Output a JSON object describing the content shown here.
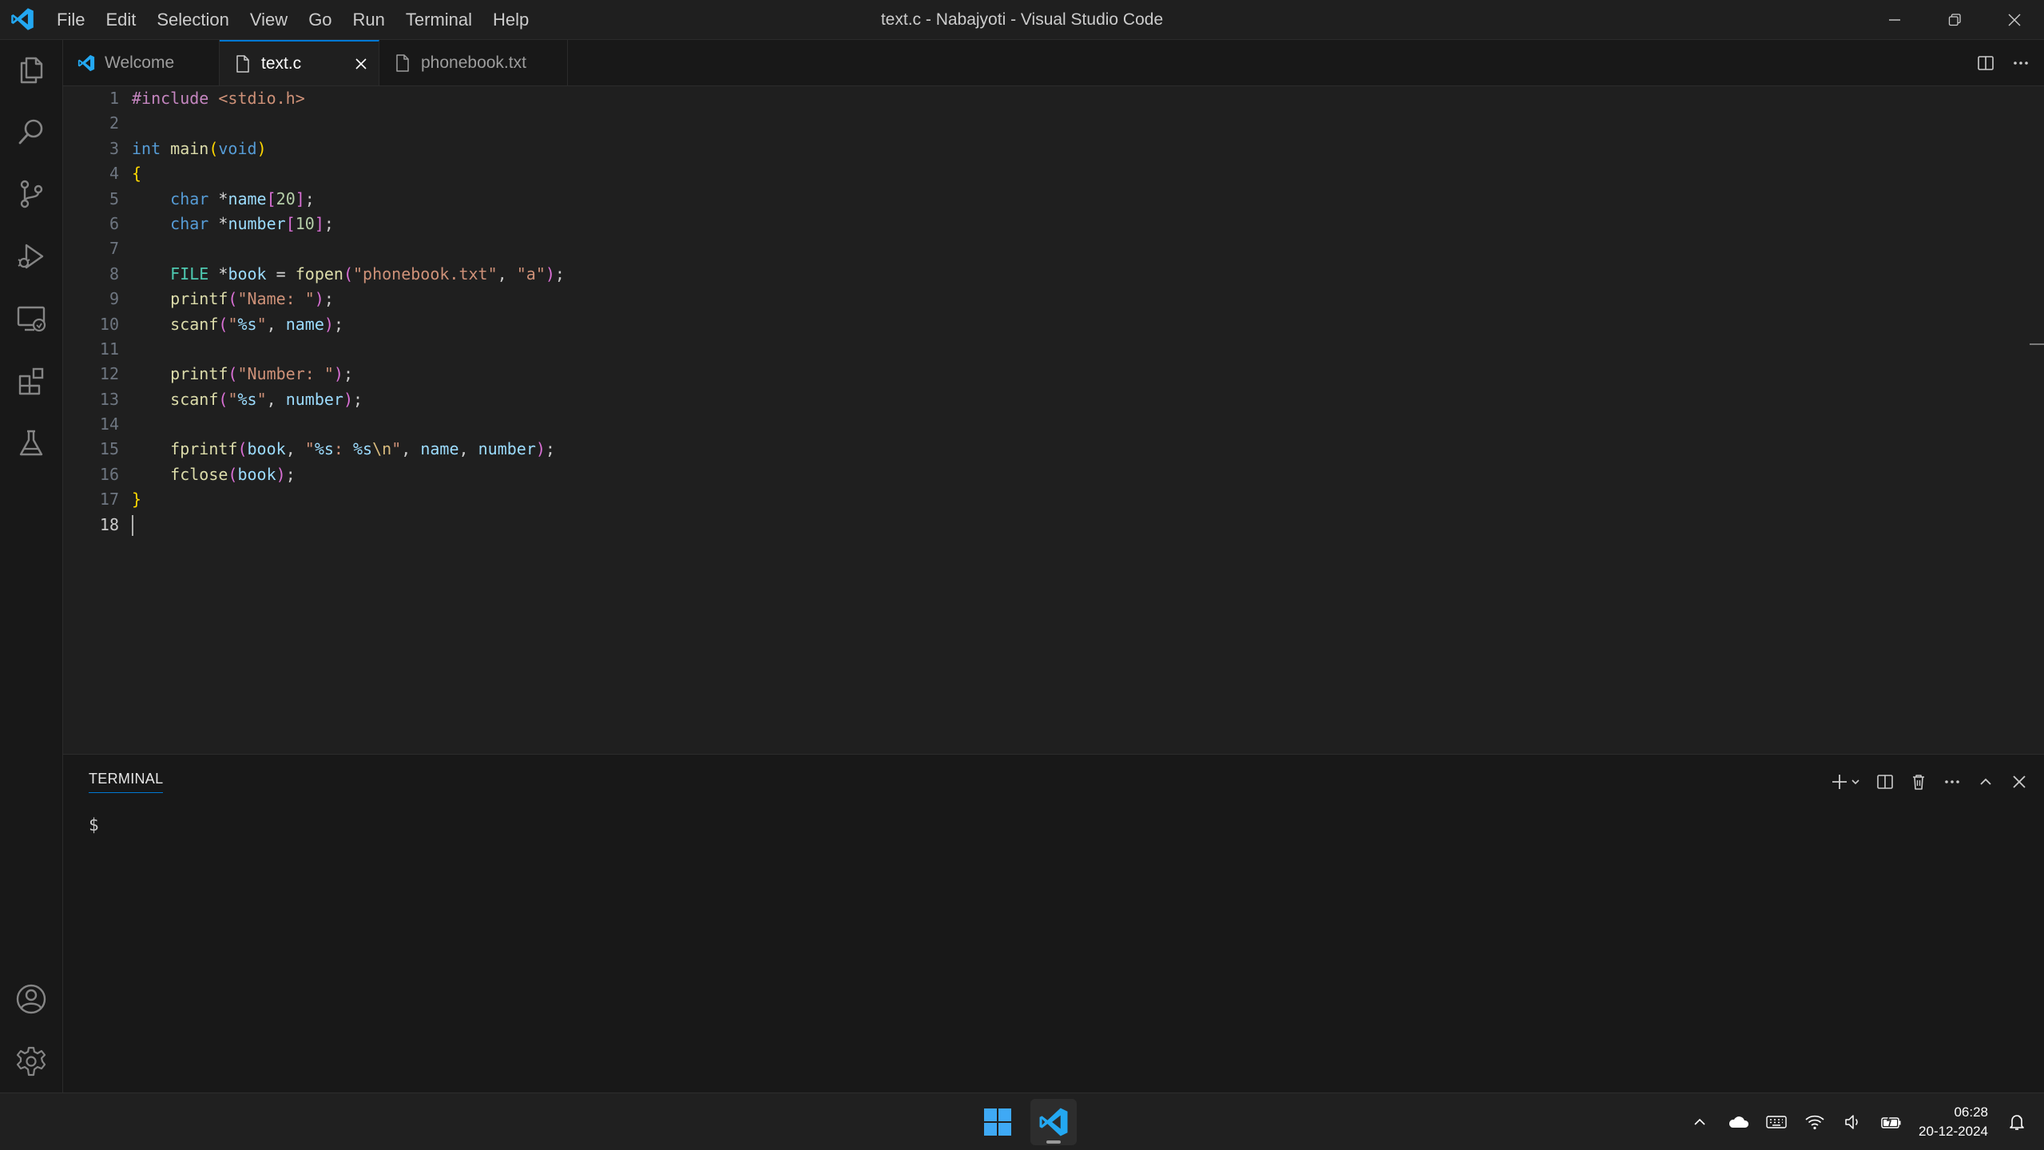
{
  "window": {
    "title": "text.c - Nabajyoti - Visual Studio Code",
    "menu": [
      "File",
      "Edit",
      "Selection",
      "View",
      "Go",
      "Run",
      "Terminal",
      "Help"
    ]
  },
  "activity_bar": {
    "top": [
      "explorer-icon",
      "search-icon",
      "source-control-icon",
      "run-debug-icon",
      "remote-explorer-icon",
      "extensions-icon",
      "testing-icon"
    ],
    "bottom": [
      "accounts-icon",
      "settings-gear-icon"
    ]
  },
  "tabs": [
    {
      "label": "Welcome",
      "icon": "vscode-logo-icon",
      "active": false
    },
    {
      "label": "text.c",
      "icon": "file-icon",
      "active": true
    },
    {
      "label": "phonebook.txt",
      "icon": "file-icon",
      "active": false
    }
  ],
  "editor": {
    "line_numbers": [
      "1",
      "2",
      "3",
      "4",
      "5",
      "6",
      "7",
      "8",
      "9",
      "10",
      "11",
      "12",
      "13",
      "14",
      "15",
      "16",
      "17",
      "18"
    ],
    "current_line": 18,
    "lines": [
      "#include <stdio.h>",
      "",
      "int main(void)",
      "{",
      "    char *name[20];",
      "    char *number[10];",
      "",
      "    FILE *book = fopen(\"phonebook.txt\", \"a\");",
      "    printf(\"Name: \");",
      "    scanf(\"%s\", name);",
      "",
      "    printf(\"Number: \");",
      "    scanf(\"%s\", number);",
      "",
      "    fprintf(book, \"%s: %s\\n\", name, number);",
      "    fclose(book);",
      "}",
      ""
    ]
  },
  "panel": {
    "tab": "TERMINAL",
    "prompt": "$"
  },
  "taskbar": {
    "apps": [
      "windows-start-icon",
      "vscode-taskbar-icon"
    ],
    "tray_icons": [
      "chevron-up-icon",
      "onedrive-icon",
      "keyboard-icon",
      "wifi-icon",
      "volume-icon",
      "battery-icon"
    ],
    "time": "06:28",
    "date": "20-12-2024",
    "notification_icon": "notification-icon"
  },
  "colors": {
    "accent": "#0078d4",
    "editor_bg": "#1f1f1f",
    "sidebar_bg": "#181818",
    "vscode_blue": "#23a8f2"
  }
}
